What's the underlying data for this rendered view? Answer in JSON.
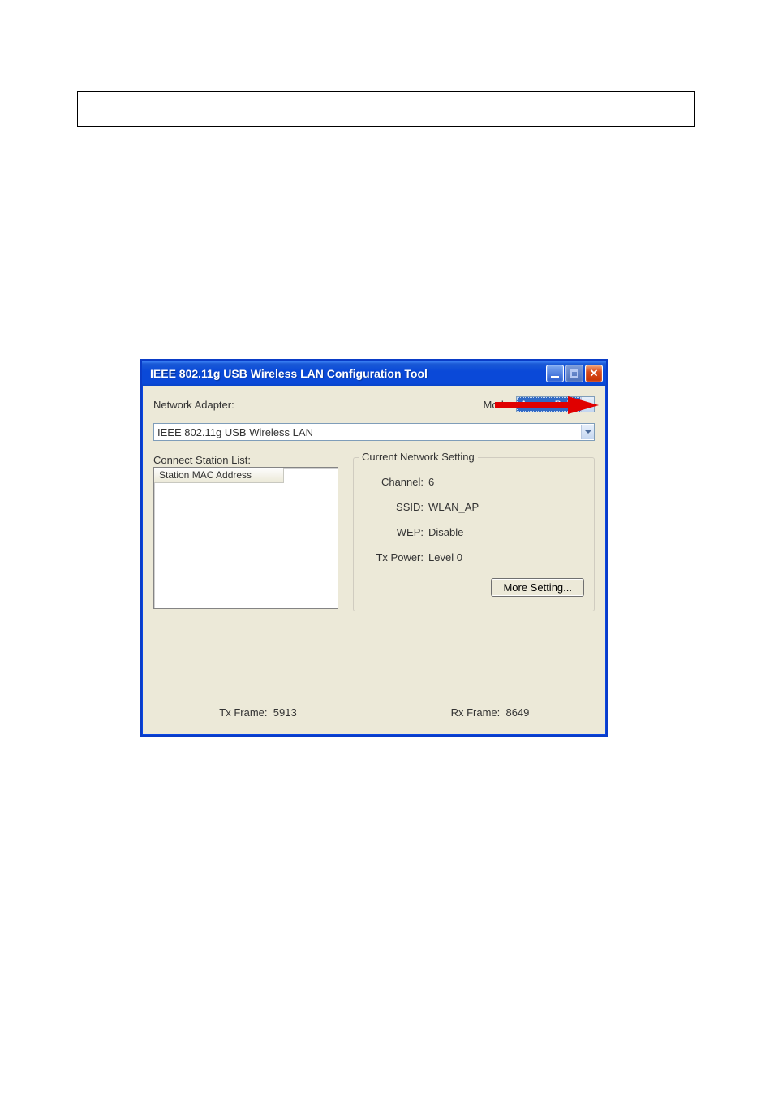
{
  "window": {
    "title": "IEEE 802.11g USB Wireless LAN Configuration Tool"
  },
  "top": {
    "network_adapter_label": "Network Adapter:",
    "mode_label": "Mode:",
    "mode_value": "Access Point",
    "adapter_value": "IEEE 802.11g USB Wireless LAN"
  },
  "left": {
    "connect_label": "Connect Station List:",
    "column_header": "Station MAC Address"
  },
  "group": {
    "title": "Current Network Setting",
    "channel_label": "Channel:",
    "channel_value": "6",
    "ssid_label": "SSID:",
    "ssid_value": "WLAN_AP",
    "wep_label": "WEP:",
    "wep_value": "Disable",
    "txpower_label": "Tx Power:",
    "txpower_value": "Level 0",
    "more_button": "More Setting..."
  },
  "footer": {
    "tx_label": "Tx Frame:",
    "tx_value": "5913",
    "rx_label": "Rx Frame:",
    "rx_value": "8649"
  }
}
